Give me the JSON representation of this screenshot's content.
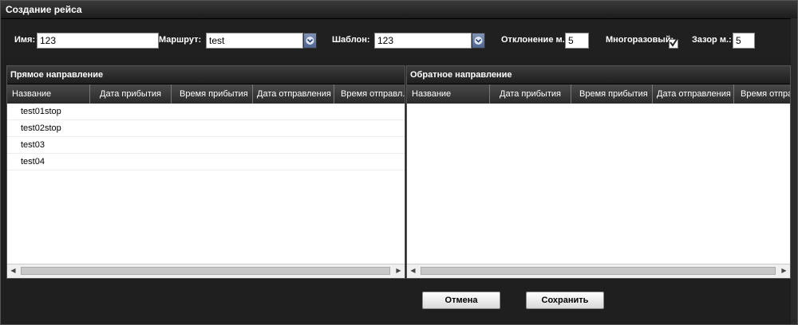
{
  "window": {
    "title": "Создание рейса"
  },
  "form": {
    "name_label": "Имя:",
    "name_value": "123",
    "route_label": "Маршрут:",
    "route_value": "test",
    "template_label": "Шаблон:",
    "template_value": "123",
    "deviation_label": "Отклонение м.:",
    "deviation_value": "5",
    "reusable_label": "Многоразовый:",
    "reusable_checked": true,
    "gap_label": "Зазор м.:",
    "gap_value": "5"
  },
  "forward": {
    "title": "Прямое направление",
    "columns": [
      "Название",
      "Дата прибытия",
      "Время прибытия",
      "Дата отправления",
      "Время отправл."
    ],
    "rows": [
      "test01stop",
      "test02stop",
      "test03",
      "test04"
    ]
  },
  "backward": {
    "title": "Обратное направление",
    "columns": [
      "Название",
      "Дата прибытия",
      "Время прибытия",
      "Дата отправления",
      "Время отпра"
    ],
    "rows": []
  },
  "buttons": {
    "cancel": "Отмена",
    "save": "Сохранить"
  },
  "icons": {
    "combo": "chevron-down-icon",
    "check": "check-icon"
  },
  "colors": {
    "window_bg": "#1f1f1f",
    "combo_btn": "#5b709a",
    "panel_bg": "#ffffff"
  }
}
